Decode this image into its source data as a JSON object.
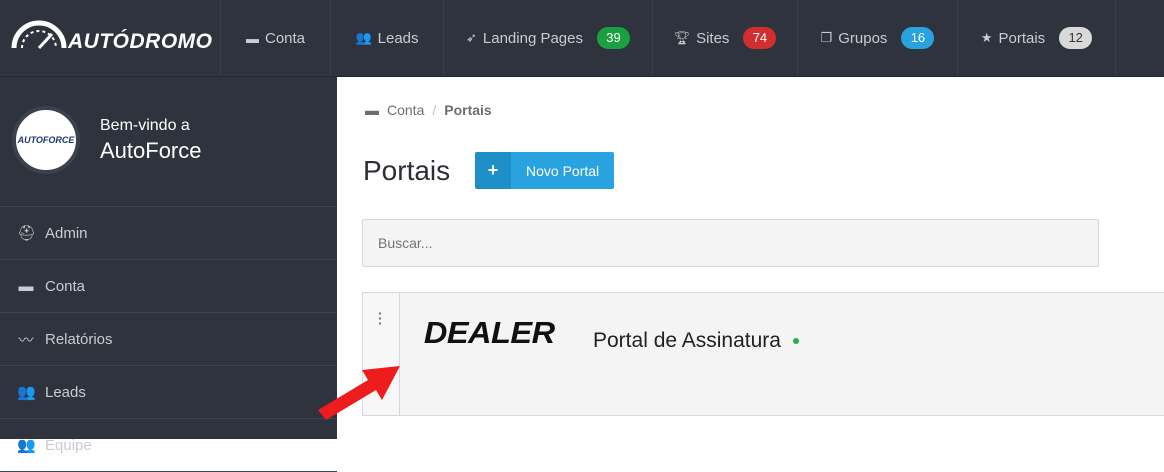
{
  "header": {
    "logo_text": "AUTÓDROMO",
    "nav": [
      {
        "label": "Conta",
        "icon": "archive-icon"
      },
      {
        "label": "Leads",
        "icon": "users-icon"
      },
      {
        "label": "Landing Pages",
        "icon": "rocket-icon",
        "badge": "39",
        "badge_color": "#1aa040"
      },
      {
        "label": "Sites",
        "icon": "trophy-icon",
        "badge": "74",
        "badge_color": "#d12f2f"
      },
      {
        "label": "Grupos",
        "icon": "cubes-icon",
        "badge": "16",
        "badge_color": "#29a3e0"
      },
      {
        "label": "Portais",
        "icon": "star-icon",
        "badge": "12",
        "badge_color": "#d9d9d9",
        "badge_text_color": "#333333"
      }
    ]
  },
  "sidebar": {
    "welcome": "Bem-vindo a",
    "company": "AutoForce",
    "avatar_text": "AUTOFORCE",
    "items": [
      {
        "label": "Admin",
        "icon": "user-admin-icon"
      },
      {
        "label": "Conta",
        "icon": "archive-icon"
      },
      {
        "label": "Relatórios",
        "icon": "chart-line-icon"
      },
      {
        "label": "Leads",
        "icon": "users-icon"
      },
      {
        "label": "Equipe",
        "icon": "team-icon"
      }
    ]
  },
  "main": {
    "breadcrumb": {
      "root": "Conta",
      "current": "Portais"
    },
    "title": "Portais",
    "new_button": {
      "icon": "+",
      "label": "Novo Portal"
    },
    "search": {
      "placeholder": "Buscar...",
      "value": ""
    },
    "portals": [
      {
        "logo_text": "DEALER",
        "name": "Portal de Assinatura",
        "status_color": "#22b14c"
      }
    ]
  }
}
